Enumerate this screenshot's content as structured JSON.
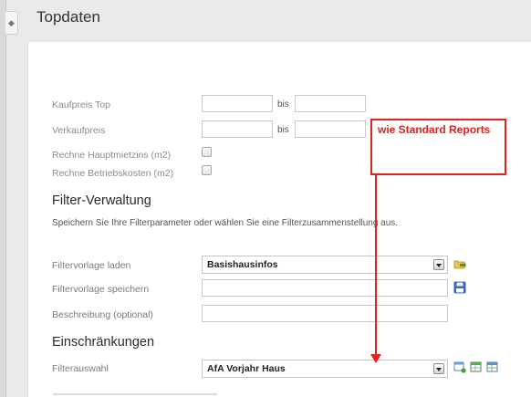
{
  "header": {
    "title": "Topdaten"
  },
  "price_filters": {
    "kaufpreis_label": "Kaufpreis Top",
    "verkaufpreis_label": "Verkaufpreis",
    "bis_label": "bis",
    "kaufpreis_von": "",
    "kaufpreis_bis": "",
    "verkaufpreis_von": "",
    "verkaufpreis_bis": "",
    "hauptmietzins_label": "Rechne Hauptmietzins (m2)",
    "betriebskosten_label": "Rechne Betriebskosten (m2)",
    "hauptmietzins_checked": false,
    "betriebskosten_checked": false
  },
  "filter_verwaltung": {
    "title": "Filter-Verwaltung",
    "description": "Speichern Sie Ihre Filterparameter oder wählen Sie eine Filterzusammenstellung aus.",
    "laden_label": "Filtervorlage laden",
    "laden_value": "Basishausinfos",
    "speichern_label": "Filtervorlage speichern",
    "speichern_value": "",
    "beschreibung_label": "Beschreibung (optional)",
    "beschreibung_value": ""
  },
  "einschraenkungen": {
    "title": "Einschränkungen",
    "filterauswahl_label": "Filterauswahl",
    "filterauswahl_value": "AfA Vorjahr Haus"
  },
  "annotation": {
    "text": "wie Standard Reports",
    "color": "#e1231b"
  },
  "icons": [
    "expand-handle-icon",
    "load-template-icon",
    "save-icon",
    "add-filter-icon",
    "filter-table-icon",
    "filter-table-2-icon"
  ]
}
